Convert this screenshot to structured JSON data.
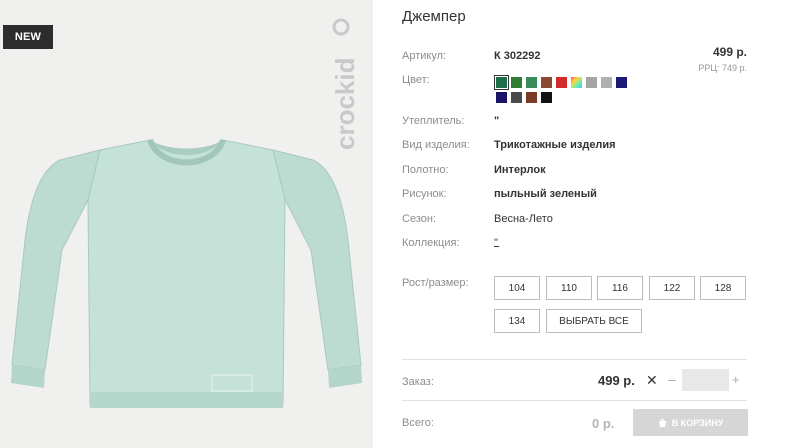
{
  "image": {
    "badge": "NEW",
    "brand": "crockid"
  },
  "product": {
    "title": "Джемпер",
    "price": "499 р.",
    "rrp": "РРЦ: 749 р."
  },
  "specs": [
    {
      "label": "Артикул:",
      "value": "К 302292",
      "bold": true
    },
    {
      "label": "Цвет:",
      "value": ""
    },
    {
      "label": "Утеплитель:",
      "value": "\"",
      "bold": true
    },
    {
      "label": "Вид изделия:",
      "value": "Трикотажные изделия",
      "bold": true
    },
    {
      "label": "Полотно:",
      "value": "Интерлок",
      "bold": true
    },
    {
      "label": "Рисунок:",
      "value": "пыльный зеленый",
      "bold": true
    },
    {
      "label": "Сезон:",
      "value": "Весна-Лето",
      "bold": false
    },
    {
      "label": "Коллекция:",
      "value": "\"",
      "bold": false
    }
  ],
  "colors": [
    "#1f6e4a",
    "#2e7d32",
    "#3a8a5c",
    "#8b4a2f",
    "#d22b2b",
    "rainbow",
    "#a5a5a5",
    "#b0b0b0",
    "#1e1a78",
    "#1a1466",
    "#4a4a4a",
    "#7a3a24",
    "#111111"
  ],
  "size_section": {
    "label": "Рост/размер:",
    "sizes": [
      "104",
      "110",
      "116",
      "122",
      "128",
      "134"
    ],
    "select_all": "ВЫБРАТЬ ВСЕ"
  },
  "order": {
    "label": "Заказ:",
    "price": "499 р.",
    "x": "✕",
    "minus": "–",
    "plus": "+",
    "qty_value": ""
  },
  "total": {
    "label": "Всего:",
    "price": "0 р.",
    "cart_button": "В КОРЗИНУ"
  }
}
